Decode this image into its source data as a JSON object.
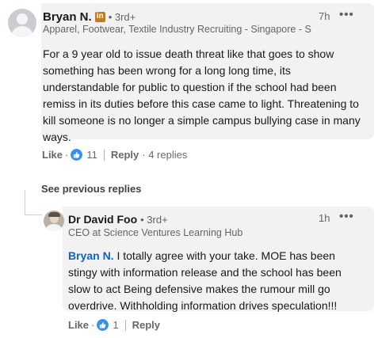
{
  "main_comment": {
    "author": "Bryan N.",
    "degree": "• 3rd+",
    "headline": "Apparel, Footwear, Textile Industry Recruiting - Singapore - S...",
    "time": "7h",
    "more": "•••",
    "text": "For a 9 year old to issue death threat like that goes to show something has been wrong for a long long time, its understandable for public to question if the school had been remiss in its duties before this case came to light. Threatening to kill someone is no longer a simple campus bullying case in many ways.",
    "actions": {
      "like": "Like",
      "dot": "·",
      "reaction_count": "11",
      "reply": "Reply",
      "replies": "· 4 replies"
    }
  },
  "see_previous": "See previous replies",
  "reply_comment": {
    "author": "Dr David Foo",
    "degree": "• 3rd+",
    "headline": "CEO at Science Ventures Learning Hub",
    "time": "1h",
    "more": "•••",
    "mention": "Bryan N.",
    "text": " I totally agree with your take. MOE has been stingy with information release and the school has been slow to act Being defensive makes the rumour mill go overdrive. Withholding information drives speculation!!!",
    "actions": {
      "like": "Like",
      "dot": "·",
      "reaction_count": "1",
      "reply": "Reply"
    }
  },
  "colors": {
    "accent": "#0a66c2",
    "reaction": "#378fe9",
    "badge": "#c37d16",
    "bubble": "#f2f2f2"
  }
}
